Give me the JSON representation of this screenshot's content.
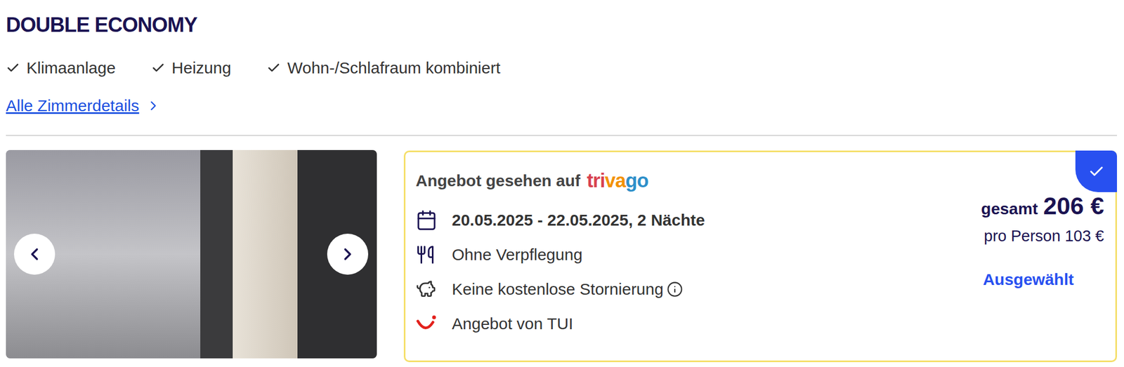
{
  "room": {
    "title": "DOUBLE ECONOMY",
    "features": [
      "Klimaanlage",
      "Heizung",
      "Wohn-/Schlafraum kombiniert"
    ],
    "details_link": "Alle Zimmerdetails"
  },
  "offer": {
    "seen_on": "Angebot gesehen auf",
    "source_logo": [
      {
        "text": "tri",
        "color": "#d8414f"
      },
      {
        "text": "va",
        "color": "#f39200"
      },
      {
        "text": "go",
        "color": "#2d8fc9"
      }
    ],
    "dates": "20.05.2025 - 22.05.2025, 2 Nächte",
    "board": "Ohne Verpflegung",
    "cancellation": "Keine kostenlose Stornierung",
    "provider": "Angebot von TUI",
    "total_label": "gesamt",
    "total": "206 €",
    "per_person": "pro Person 103 €",
    "status": "Ausgewählt",
    "selected": true
  }
}
